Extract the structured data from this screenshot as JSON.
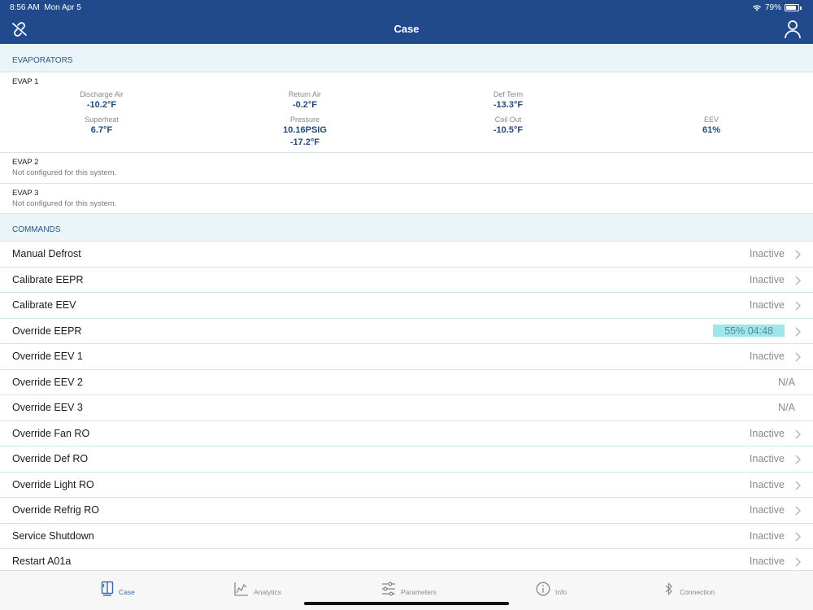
{
  "status_bar": {
    "time": "8:56 AM",
    "date": "Mon Apr 5",
    "battery": "79%"
  },
  "header": {
    "title": "Case"
  },
  "evaporators": {
    "section_label": "EVAPORATORS",
    "evap1": {
      "title": "EVAP 1",
      "row1": [
        {
          "label": "Discharge Air",
          "value": "-10.2°F"
        },
        {
          "label": "Return Air",
          "value": "-0.2°F"
        },
        {
          "label": "Def Term",
          "value": "-13.3°F"
        }
      ],
      "row2": [
        {
          "label": "Superheat",
          "value": "6.7°F"
        },
        {
          "label": "Pressure",
          "value": "10.16PSIG",
          "value2": "-17.2°F"
        },
        {
          "label": "Coil Out",
          "value": "-10.5°F"
        },
        {
          "label": "EEV",
          "value": "61%"
        }
      ]
    },
    "evap2": {
      "title": "EVAP 2",
      "note": "Not configured for this system."
    },
    "evap3": {
      "title": "EVAP 3",
      "note": "Not configured for this system."
    }
  },
  "commands": {
    "section_label": "COMMANDS",
    "items": [
      {
        "label": "Manual Defrost",
        "status": "Inactive"
      },
      {
        "label": "Calibrate EEPR",
        "status": "Inactive"
      },
      {
        "label": "Calibrate EEV",
        "status": "Inactive"
      },
      {
        "label": "Override EEPR",
        "status": "55% 04:48"
      },
      {
        "label": "Override EEV 1",
        "status": "Inactive"
      },
      {
        "label": "Override EEV 2",
        "status": "N/A"
      },
      {
        "label": "Override EEV 3",
        "status": "N/A"
      },
      {
        "label": "Override Fan RO",
        "status": "Inactive"
      },
      {
        "label": "Override Def RO",
        "status": "Inactive"
      },
      {
        "label": "Override Light RO",
        "status": "Inactive"
      },
      {
        "label": "Override Refrig RO",
        "status": "Inactive"
      },
      {
        "label": "Service Shutdown",
        "status": "Inactive"
      },
      {
        "label": "Restart A01a",
        "status": "Inactive"
      }
    ]
  },
  "tabbar": {
    "tabs": [
      {
        "label": "Case",
        "icon": "case-icon"
      },
      {
        "label": "Analytics",
        "icon": "analytics-icon"
      },
      {
        "label": "Parameters",
        "icon": "sliders-icon"
      },
      {
        "label": "Info",
        "icon": "info-icon"
      },
      {
        "label": "Connection",
        "icon": "bluetooth-icon"
      }
    ],
    "active_color": "#3b6aa8"
  },
  "colors": {
    "header_bg": "#204a8c",
    "section_bg": "#eaf4f9",
    "active_highlight": "#9de6ec"
  }
}
